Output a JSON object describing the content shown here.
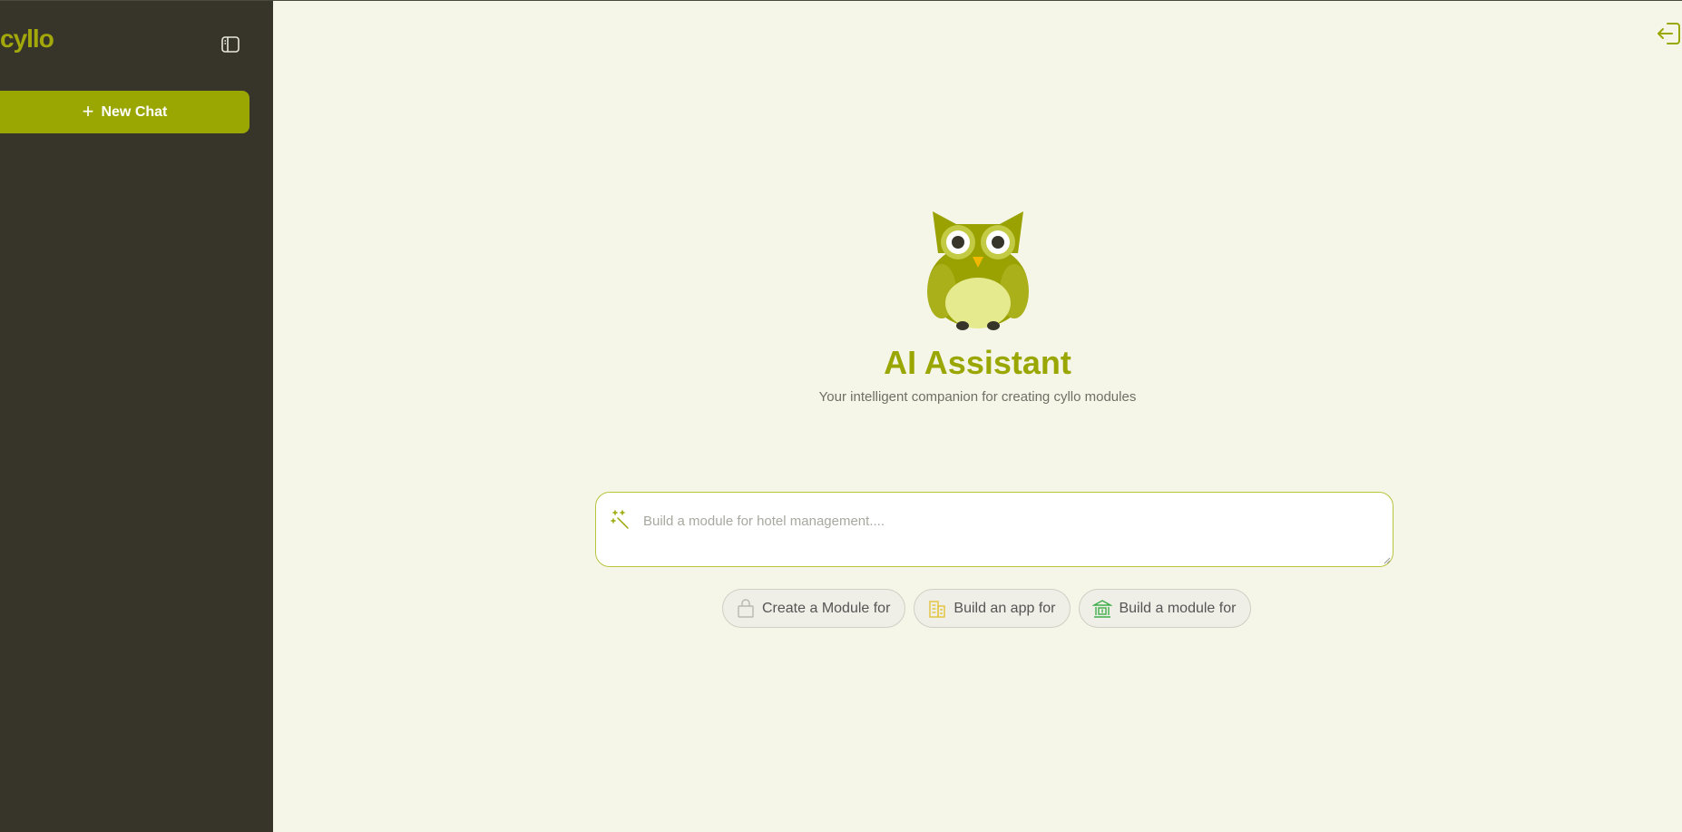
{
  "sidebar": {
    "logo": "cyllo",
    "new_chat_label": "New Chat"
  },
  "hero": {
    "title": "AI Assistant",
    "subtitle": "Your intelligent companion for creating cyllo modules"
  },
  "prompt": {
    "placeholder": "Build a module for hotel management....",
    "value": ""
  },
  "suggestions": [
    {
      "label": "Create a Module for",
      "icon": "shopping-bag-icon"
    },
    {
      "label": "Build an app for",
      "icon": "building-icon"
    },
    {
      "label": "Build a module for",
      "icon": "bank-icon"
    }
  ],
  "colors": {
    "accent": "#9aa703",
    "sidebar_bg": "#37352a",
    "main_bg": "#f5f5e8"
  }
}
